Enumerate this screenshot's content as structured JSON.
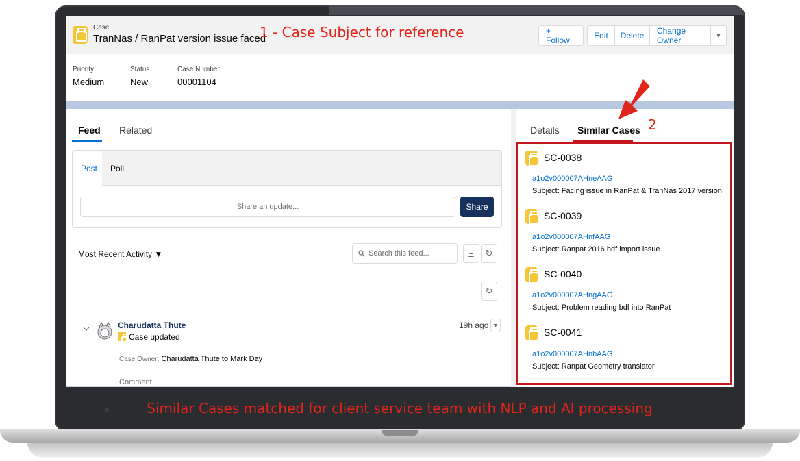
{
  "header": {
    "object_label": "Case",
    "title": "TranNas / RanPat version issue faced",
    "annotation": "1 - Case Subject for reference",
    "follow_label": "+ Follow",
    "edit_label": "Edit",
    "delete_label": "Delete",
    "change_owner_label": "Change Owner",
    "more_label": "▼"
  },
  "fields": {
    "priority_label": "Priority",
    "priority_value": "Medium",
    "status_label": "Status",
    "status_value": "New",
    "case_number_label": "Case Number",
    "case_number_value": "00001104"
  },
  "left_tabs": {
    "feed": "Feed",
    "related": "Related"
  },
  "publisher": {
    "post_tab": "Post",
    "poll_tab": "Poll",
    "share_placeholder": "Share an update...",
    "share_button": "Share"
  },
  "feed": {
    "sort_label": "Most Recent Activity ▼",
    "search_placeholder": "Search this feed...",
    "filter_icon": "Ξ",
    "refresh_icon": "↻",
    "item": {
      "author": "Charudatta Thute",
      "action": "Case updated",
      "time": "19h ago",
      "detail_label": "Case Owner:",
      "detail_value": "Charudatta Thute to Mark Day",
      "comment_label": "Comment"
    }
  },
  "right_tabs": {
    "details": "Details",
    "similar_cases": "Similar Cases",
    "annotation": "2"
  },
  "similar_cases": [
    {
      "id": "SC-0038",
      "record_id": "a1o2v000007AHneAAG",
      "subject": "Subject: Facing issue in RanPat & TranNas 2017 version"
    },
    {
      "id": "SC-0039",
      "record_id": "a1o2v000007AHnfAAG",
      "subject": "Subject: Ranpat 2016 bdf import issue"
    },
    {
      "id": "SC-0040",
      "record_id": "a1o2v000007AHngAAG",
      "subject": "Subject: Problem reading bdf into RanPat"
    },
    {
      "id": "SC-0041",
      "record_id": "a1o2v000007AHnhAAG",
      "subject": "Subject: Ranpat Geometry translator"
    }
  ],
  "caption": "Similar Cases matched for client service team with NLP and AI processing",
  "colors": {
    "brand_blue": "#0070d2",
    "share_button": "#16325c",
    "case_icon": "#f5c638",
    "annotation_red": "#e0251b",
    "highlight_border": "#c4161c"
  },
  "icons": {
    "case": "case-icon",
    "arrow": "red-arrow-icon",
    "search": "search-icon",
    "filter": "filter-icon",
    "refresh": "refresh-icon",
    "collapse": "chevron-down-icon",
    "avatar": "avatar"
  }
}
